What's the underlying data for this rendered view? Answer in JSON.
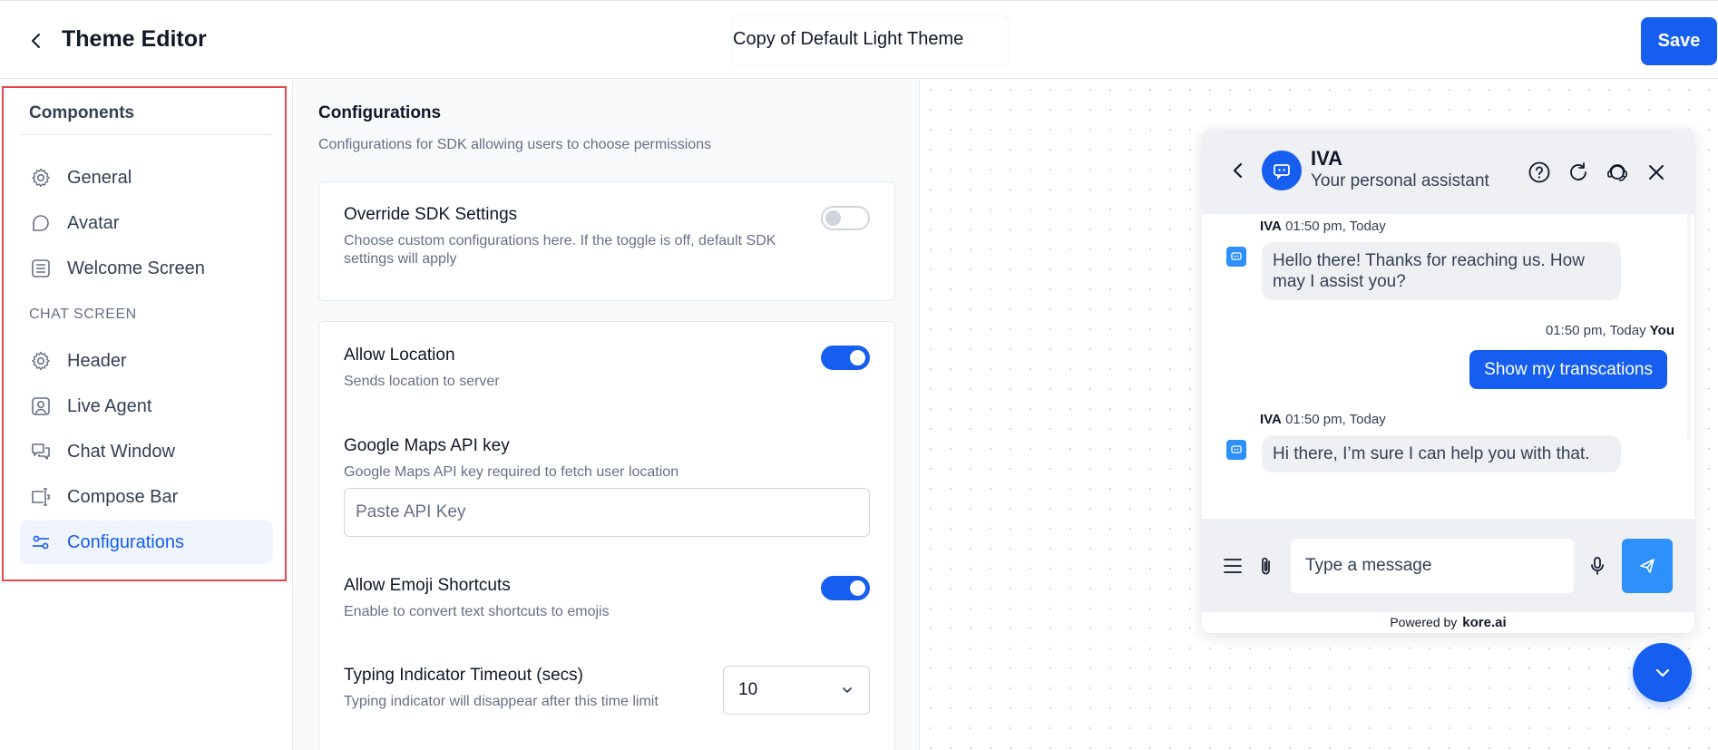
{
  "header": {
    "title": "Theme Editor",
    "theme_name": "Copy of Default Light Theme",
    "save_label": "Save"
  },
  "sidebar": {
    "title": "Components",
    "items": [
      {
        "label": "General",
        "icon": "gear-icon"
      },
      {
        "label": "Avatar",
        "icon": "chat-bubble-icon"
      },
      {
        "label": "Welcome Screen",
        "icon": "list-icon"
      }
    ],
    "section_label": "CHAT SCREEN",
    "chat_items": [
      {
        "label": "Header",
        "icon": "gear-icon"
      },
      {
        "label": "Live Agent",
        "icon": "user-icon"
      },
      {
        "label": "Chat Window",
        "icon": "chats-icon"
      },
      {
        "label": "Compose Bar",
        "icon": "compose-icon"
      },
      {
        "label": "Configurations",
        "icon": "sliders-icon",
        "active": true
      }
    ]
  },
  "config": {
    "title": "Configurations",
    "subtitle": "Configurations for SDK allowing users to choose permissions",
    "override": {
      "title": "Override SDK Settings",
      "desc": "Choose custom configurations here. If the toggle is off, default SDK settings will apply",
      "enabled": false
    },
    "location": {
      "title": "Allow Location",
      "desc": "Sends location to server",
      "enabled": true
    },
    "maps_key": {
      "title": "Google Maps API key",
      "desc": "Google Maps API key required to fetch user location",
      "placeholder": "Paste API Key"
    },
    "emoji": {
      "title": "Allow Emoji Shortcuts",
      "desc": "Enable to convert text shortcuts to emojis",
      "enabled": true
    },
    "typing": {
      "title": "Typing Indicator Timeout (secs)",
      "desc": "Typing indicator will disappear after this time limit",
      "value": "10"
    }
  },
  "chat": {
    "bot_name": "IVA",
    "bot_subtitle": "Your personal assistant",
    "messages": [
      {
        "sender": "IVA",
        "time": "01:50 pm, Today",
        "text": "Hello there! Thanks for reaching us. How may I assist you?"
      },
      {
        "sender": "You",
        "time": "01:50 pm, Today",
        "text": "Show my transcations"
      },
      {
        "sender": "IVA",
        "time": "01:50 pm, Today",
        "text": "Hi there, I’m sure I can help you with that."
      }
    ],
    "compose_placeholder": "Type a message",
    "powered_by": "Powered by",
    "brand": "kore.ai"
  },
  "colors": {
    "accent": "#155eef",
    "highlight_border": "#e5484d",
    "bot_icon": "#2e90fa"
  }
}
